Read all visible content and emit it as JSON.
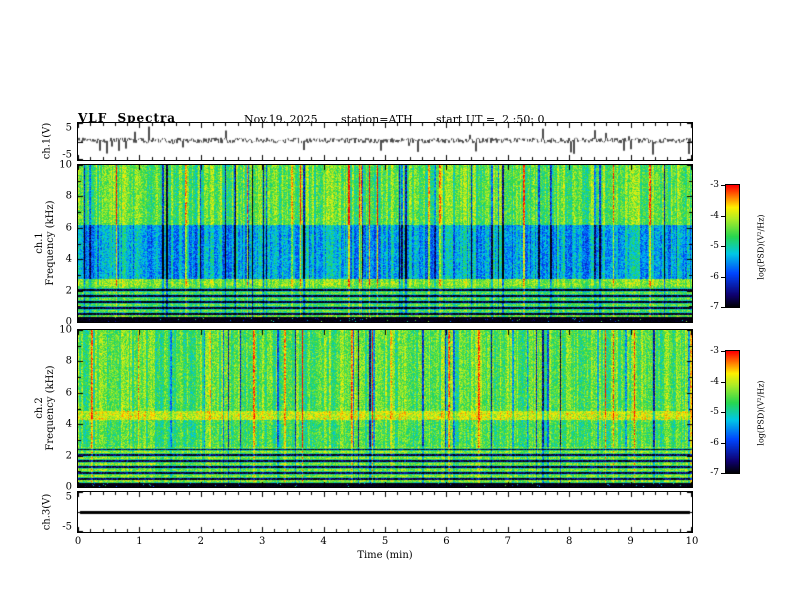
{
  "header": {
    "title": "VLF Spectra",
    "date": "Nov.19, 2025",
    "station": "station=ATH",
    "start_ut": "start UT =  2 :50: 0"
  },
  "axes": {
    "x_label": "Time (min)",
    "x_ticks": [
      "0",
      "1",
      "2",
      "3",
      "4",
      "5",
      "6",
      "7",
      "8",
      "9",
      "10"
    ],
    "x_range": [
      0,
      10
    ]
  },
  "panels": [
    {
      "name": "ch1-voltage",
      "ylabel": "ch.1(V)",
      "yticks": [
        5,
        -5
      ],
      "yrange": [
        -5,
        5
      ]
    },
    {
      "name": "ch1-spectrogram",
      "ylabel_line1": "ch.1",
      "ylabel_line2": "Frequency (kHz)",
      "yticks": [
        10,
        8,
        6,
        4,
        2,
        0
      ],
      "yrange": [
        0,
        10
      ]
    },
    {
      "name": "ch2-spectrogram",
      "ylabel_line1": "ch.2",
      "ylabel_line2": "Frequency (kHz)",
      "yticks": [
        10,
        8,
        6,
        4,
        2,
        0
      ],
      "yrange": [
        0,
        10
      ]
    },
    {
      "name": "ch3-voltage",
      "ylabel": "ch.3(V)",
      "yticks": [
        5,
        -5
      ],
      "yrange": [
        -5,
        5
      ]
    }
  ],
  "colorbars": [
    {
      "label": "log(PSD)(V²/Hz)",
      "ticks": [
        -3,
        -4,
        -5,
        -6,
        -7
      ],
      "range": [
        -7,
        -3
      ]
    },
    {
      "label": "log(PSD)(V²/Hz)",
      "ticks": [
        -3,
        -4,
        -5,
        -6,
        -7
      ],
      "range": [
        -7,
        -3
      ]
    }
  ],
  "chart_data": [
    {
      "panel": "ch.1(V)",
      "type": "line",
      "xlabel": "Time (min)",
      "xlim": [
        0,
        10
      ],
      "ylim": [
        -5,
        5
      ],
      "description": "Dense high-frequency noisy voltage waveform fluctuating around 0 V with impulsive spikes reaching about ±4 V",
      "baseline": 0.3,
      "noise_amp": 0.8,
      "spike_prob": 0.04,
      "spike_max": 4
    },
    {
      "panel": "ch.1 Frequency (kHz)",
      "type": "heatmap",
      "xlim": [
        0,
        10
      ],
      "ylim": [
        0,
        10
      ],
      "zlim": [
        -7,
        -3
      ],
      "xlabel": "Time (min)",
      "ylabel": "Frequency (kHz)",
      "zlabel": "log(PSD)(V²/Hz)",
      "colormap": "black-blue-cyan-green-yellow-red",
      "legend_position": "right colorbar",
      "bands": [
        {
          "f0": 0,
          "f1": 0.35,
          "set": -7
        },
        {
          "f0": 0.35,
          "f1": 2.3,
          "base": -5.0,
          "stripes": true,
          "streak": 0.5
        },
        {
          "f0": 2.3,
          "f1": 2.75,
          "base": -4.3,
          "streak": 0.7
        },
        {
          "f0": 2.75,
          "f1": 6.2,
          "base": -5.4,
          "streak": 1.1
        },
        {
          "f0": 6.2,
          "f1": 10,
          "base": -4.5,
          "streak": 1.0
        }
      ],
      "streaks": {
        "dark_prob": 0.07,
        "bright_prob": 0.03
      },
      "seed": 101
    },
    {
      "panel": "ch.2 Frequency (kHz)",
      "type": "heatmap",
      "xlim": [
        0,
        10
      ],
      "ylim": [
        0,
        10
      ],
      "zlim": [
        -7,
        -3
      ],
      "xlabel": "Time (min)",
      "ylabel": "Frequency (kHz)",
      "zlabel": "log(PSD)(V²/Hz)",
      "colormap": "black-blue-cyan-green-yellow-red",
      "legend_position": "right colorbar",
      "bands": [
        {
          "f0": 0,
          "f1": 0.3,
          "set": -7
        },
        {
          "f0": 0.3,
          "f1": 2.6,
          "base": -4.8,
          "stripes": true,
          "streak": 0.45
        },
        {
          "f0": 2.6,
          "f1": 4.3,
          "base": -4.6,
          "streak": 0.8
        },
        {
          "f0": 4.3,
          "f1": 4.9,
          "base": -3.95,
          "streak": 0.5
        },
        {
          "f0": 4.9,
          "f1": 10,
          "base": -4.5,
          "streak": 0.9
        }
      ],
      "streaks": {
        "dark_prob": 0.05,
        "bright_prob": 0.03
      },
      "seed": 202
    },
    {
      "panel": "ch.3(V)",
      "type": "line",
      "xlim": [
        0,
        10
      ],
      "ylim": [
        -5,
        5
      ],
      "description": "Constant flat line at 0 V (no signal on channel 3)",
      "value": 0
    }
  ]
}
